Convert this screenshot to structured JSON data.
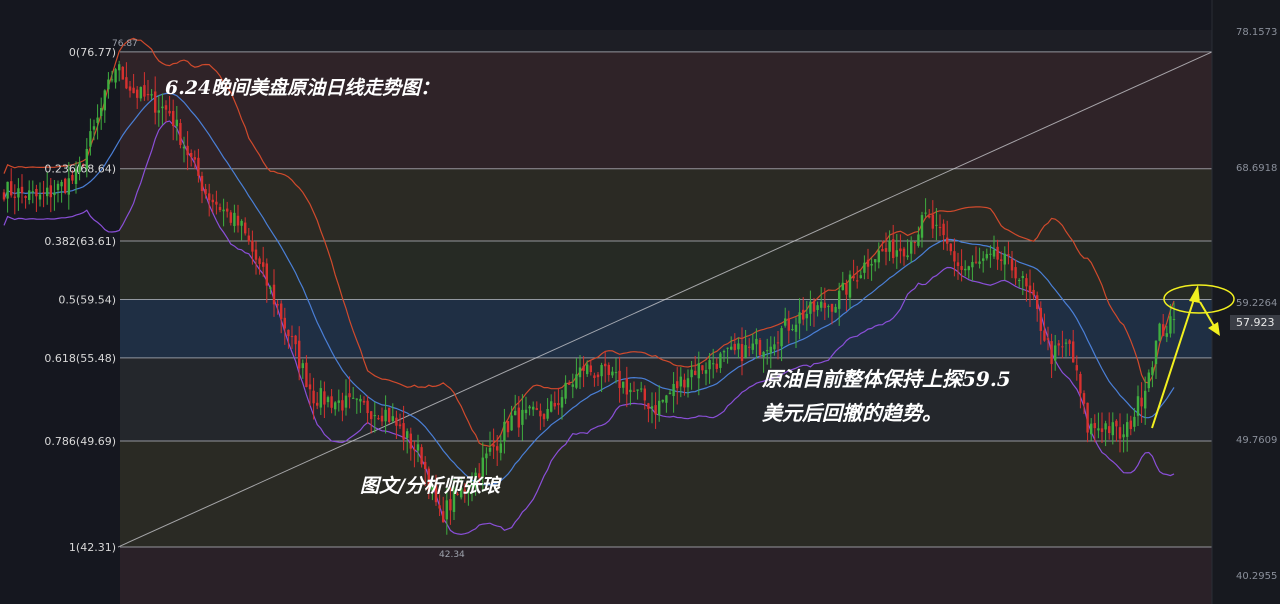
{
  "chart_data": {
    "type": "candlestick",
    "title": "6.24晚间美盘原油日线走势图：",
    "annotations": {
      "author": "图文/分析师张琅",
      "comment_line1": "原油目前整体保持上探59.5",
      "comment_line2": "美元后回撤的趋势。"
    },
    "y_range": [
      40.2955,
      78.1573
    ],
    "price_axis_labels": [
      "78.1573",
      "68.6918",
      "59.2264",
      "49.7609",
      "40.2955"
    ],
    "current_price": "57.923",
    "extremes": {
      "high": "76.87",
      "low": "42.34"
    },
    "fibonacci_levels": [
      {
        "label": "0(76.77)",
        "price": 76.77
      },
      {
        "label": "0.236(68.64)",
        "price": 68.64
      },
      {
        "label": "0.382(63.61)",
        "price": 63.61
      },
      {
        "label": "0.5(59.54)",
        "price": 59.54
      },
      {
        "label": "0.618(55.48)",
        "price": 55.48
      },
      {
        "label": "0.786(49.69)",
        "price": 49.69
      },
      {
        "label": "1(42.31)",
        "price": 42.31
      }
    ],
    "close_anchors": [
      [
        0,
        67.2
      ],
      [
        10,
        66.6
      ],
      [
        20,
        68.0
      ],
      [
        26,
        72.0
      ],
      [
        31,
        75.8
      ],
      [
        36,
        74.0
      ],
      [
        46,
        72.6
      ],
      [
        56,
        67.0
      ],
      [
        66,
        64.5
      ],
      [
        76,
        59.0
      ],
      [
        86,
        52.8
      ],
      [
        96,
        52.2
      ],
      [
        106,
        51.7
      ],
      [
        116,
        48.6
      ],
      [
        121,
        44.4
      ],
      [
        131,
        47.4
      ],
      [
        141,
        51.2
      ],
      [
        151,
        51.6
      ],
      [
        161,
        54.8
      ],
      [
        171,
        53.8
      ],
      [
        181,
        52.0
      ],
      [
        191,
        54.6
      ],
      [
        201,
        55.6
      ],
      [
        211,
        56.4
      ],
      [
        221,
        58.4
      ],
      [
        231,
        59.4
      ],
      [
        241,
        62.6
      ],
      [
        251,
        63.3
      ],
      [
        256,
        65.2
      ],
      [
        261,
        63.6
      ],
      [
        266,
        61.6
      ],
      [
        276,
        62.4
      ],
      [
        281,
        61.6
      ],
      [
        286,
        59.2
      ],
      [
        291,
        55.6
      ],
      [
        296,
        56.4
      ],
      [
        301,
        50.6
      ],
      [
        306,
        50.8
      ],
      [
        311,
        49.9
      ],
      [
        316,
        52.8
      ],
      [
        321,
        57.3
      ],
      [
        325,
        57.9
      ]
    ],
    "moving_average_color": "#4a7fd6",
    "bollinger_upper_color": "#d04a2c",
    "bollinger_lower_color": "#8a4fd8",
    "bull_color": "#3fae3f",
    "bear_color": "#d6312f",
    "arrow_color": "#f2f01f"
  }
}
